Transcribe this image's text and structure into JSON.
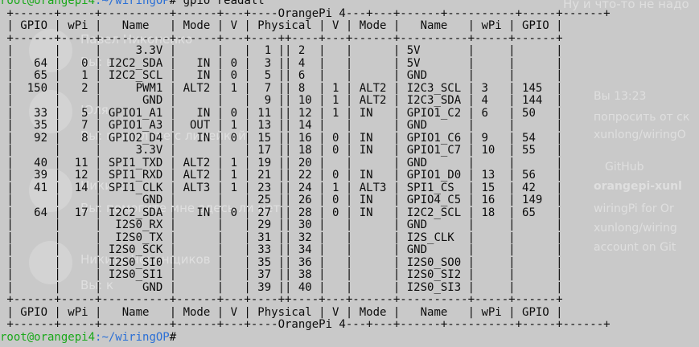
{
  "background_texts": [
    "Ну и что-то не надо",
    "Павел Никоненко",
    "Вы: в",
    "Юля",
    "Вы: пришлите с линейкой",
    "Никита",
    "Вы: помогите мне здесь ли нет",
    "Никита Черенщиков",
    "Вы: к",
    "Вы 13:23",
    "попросить от ск",
    "xunlong/wiringO",
    "GitHub",
    "orangepi-xunl",
    "wiringPi for Or",
    "xunlong/wiring",
    "account on Git"
  ],
  "terminal": {
    "command_user": "root@orangepi4",
    "command_path": ":~/wiringOP",
    "command_rest": "# gpio readall",
    "border_top": " +------+-----+----------+------+---+----OrangePi 4---+---+------+----------+-----+------+",
    "header_row": " | GPIO | wPi |   Name   | Mode | V | Physical | V | Mode |   Name   | wPi | GPIO |",
    "separator": " +------+-----+----------+------+---+----++----+---+------+----------+-----+------+",
    "rows": [
      " |      |     |     3.3V |      |   |  1 || 2  |   |      | 5V       |     |      |",
      " |   64 |   0 | I2C2_SDA |   IN | 0 |  3 || 4  |   |      | 5V       |     |      |",
      " |   65 |   1 | I2C2_SCL |   IN | 0 |  5 || 6  |   |      | GND      |     |      |",
      " |  150 |   2 |     PWM1 | ALT2 | 1 |  7 || 8  | 1 | ALT2 | I2C3_SCL | 3   | 145  |",
      " |      |     |      GND |      |   |  9 || 10 | 1 | ALT2 | I2C3_SDA | 4   | 144  |",
      " |   33 |   5 | GPIO1_A1 |   IN | 0 | 11 || 12 | 1 | IN   | GPIO1_C2 | 6   | 50   |",
      " |   35 |   7 | GPIO1_A3 |  OUT | 1 | 13 || 14 |   |      | GND      |     |      |",
      " |   92 |   8 | GPIO2_D4 |   IN | 0 | 15 || 16 | 0 | IN   | GPIO1_C6 | 9   | 54   |",
      " |      |     |     3.3V |      |   | 17 || 18 | 0 | IN   | GPIO1_C7 | 10  | 55   |",
      " |   40 |  11 | SPI1_TXD | ALT2 | 1 | 19 || 20 |   |      | GND      |     |      |",
      " |   39 |  12 | SPI1_RXD | ALT2 | 1 | 21 || 22 | 0 | IN   | GPIO1_D0 | 13  | 56   |",
      " |   41 |  14 | SPI1_CLK | ALT3 | 1 | 23 || 24 | 1 | ALT3 | SPI1_CS  | 15  | 42   |",
      " |      |     |      GND |      |   | 25 || 26 | 0 | IN   | GPIO4_C5 | 16  | 149  |",
      " |   64 |  17 | I2C2_SDA |   IN | 0 | 27 || 28 | 0 | IN   | I2C2_SCL | 18  | 65   |",
      " |      |     |  I2S0_RX |      |   | 29 || 30 |   |      | GND      |     |      |",
      " |      |     |  I2S0_TX |      |   | 31 || 32 |   |      | I2S_CLK  |     |      |",
      " |      |     | I2S0_SCK |      |   | 33 || 34 |   |      | GND      |     |      |",
      " |      |     | I2S0_SI0 |      |   | 35 || 36 |   |      | I2S0_SO0 |     |      |",
      " |      |     | I2S0_SI1 |      |   | 37 || 38 |   |      | I2S0_SI2 |     |      |",
      " |      |     |      GND |      |   | 39 || 40 |   |      | I2S0_SI3 |     |      |"
    ],
    "footer_row": " | GPIO | wPi |   Name   | Mode | V | Physical | V | Mode |   Name   | wPi | GPIO |",
    "border_bottom": " +------+-----+----------+------+---+----OrangePi 4---+---+------+----------+-----+------+",
    "prompt_user": "root@orangepi4",
    "prompt_path": ":~/wiringOP",
    "prompt_rest": "# "
  },
  "colors": {
    "background": "#c9c9c9",
    "text": "#0c0c0c",
    "prompt_user": "#1aa81a",
    "prompt_path": "#2a6fd6"
  }
}
